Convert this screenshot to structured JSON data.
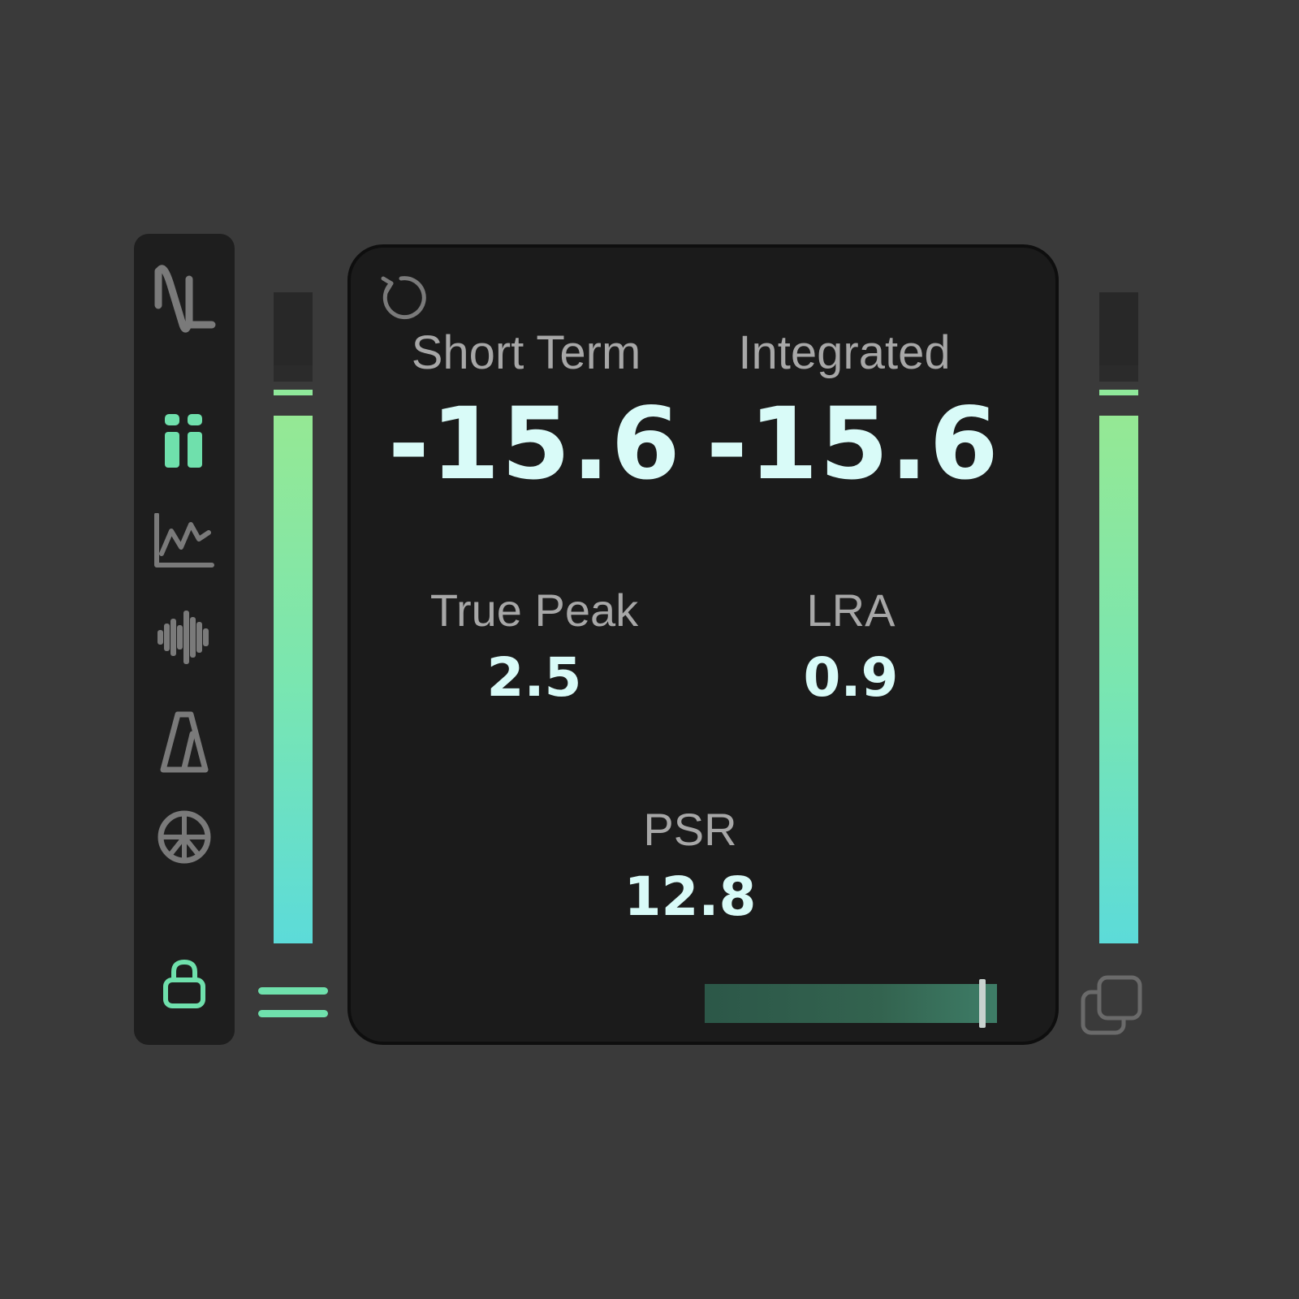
{
  "sidebar": {
    "logo": "nl-logo-icon",
    "items": [
      {
        "icon": "pause-bars-icon",
        "active": true
      },
      {
        "icon": "graph-icon",
        "active": false
      },
      {
        "icon": "waveform-icon",
        "active": false
      },
      {
        "icon": "metronome-icon",
        "active": false
      },
      {
        "icon": "target-icon",
        "active": false
      }
    ],
    "lock_icon": "lock-icon"
  },
  "meters": {
    "left": {
      "level": 0.81,
      "peak": 0.83
    },
    "right": {
      "level": 0.81,
      "peak": 0.83
    }
  },
  "panel": {
    "short_term": {
      "label": "Short Term",
      "value": "-15.6"
    },
    "integrated": {
      "label": "Integrated",
      "value": "-15.6"
    },
    "true_peak": {
      "label": "True Peak",
      "value": "2.5"
    },
    "lra": {
      "label": "LRA",
      "value": "0.9"
    },
    "psr": {
      "label": "PSR",
      "value": "12.8"
    },
    "slider_position": 0.96
  },
  "colors": {
    "background": "#3a3a3a",
    "panel": "#1b1b1b",
    "accent": "#6fe0ac",
    "value_text": "#d9fbf8",
    "label_text": "#a7a7a7",
    "icon_inactive": "#7a7a7a"
  }
}
